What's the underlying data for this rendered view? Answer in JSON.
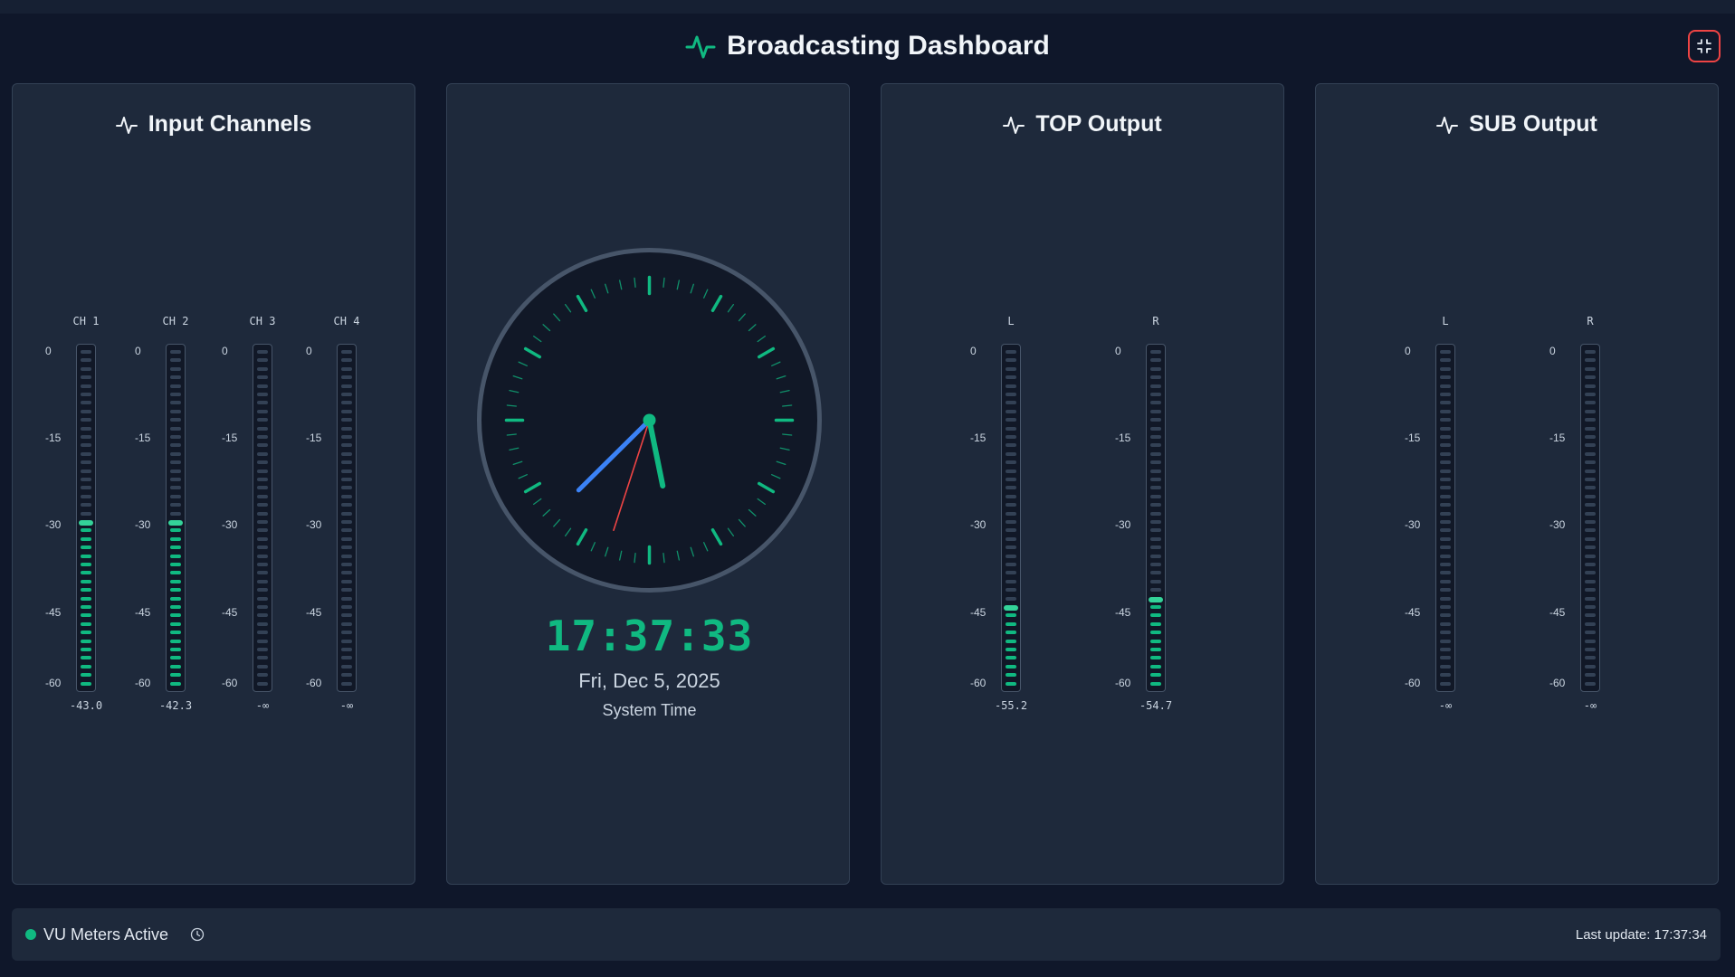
{
  "header": {
    "title": "Broadcasting Dashboard",
    "accent": "#10b981",
    "exit_icon": "minimize-icon"
  },
  "panels": {
    "input": {
      "title": "Input Channels",
      "meters": [
        {
          "label": "CH 1",
          "value": "-43.0",
          "level_db": -43.0,
          "peak_db": -31.0
        },
        {
          "label": "CH 2",
          "value": "-42.3",
          "level_db": -42.3,
          "peak_db": -31.0
        },
        {
          "label": "CH 3",
          "value": "-∞",
          "level_db": null,
          "peak_db": null
        },
        {
          "label": "CH 4",
          "value": "-∞",
          "level_db": null,
          "peak_db": null
        }
      ]
    },
    "top": {
      "title": "TOP Output",
      "meters": [
        {
          "label": "L",
          "value": "-55.2",
          "level_db": -55.2,
          "peak_db": -46.0
        },
        {
          "label": "R",
          "value": "-54.7",
          "level_db": -54.7,
          "peak_db": -44.0
        }
      ]
    },
    "sub": {
      "title": "SUB Output",
      "meters": [
        {
          "label": "L",
          "value": "-∞",
          "level_db": null,
          "peak_db": null
        },
        {
          "label": "R",
          "value": "-∞",
          "level_db": null,
          "peak_db": null
        }
      ]
    }
  },
  "scale": [
    "0",
    "-15",
    "-30",
    "-45",
    "-60"
  ],
  "clock": {
    "time": "17:37:33",
    "date": "Fri, Dec 5, 2025",
    "caption": "System Time",
    "hours": 17,
    "minutes": 37,
    "seconds": 33,
    "hour_color": "#10b981",
    "minute_color": "#3b82f6",
    "second_color": "#ef4444"
  },
  "footer": {
    "status": "VU Meters Active",
    "last_update": "Last update: 17:37:34"
  }
}
